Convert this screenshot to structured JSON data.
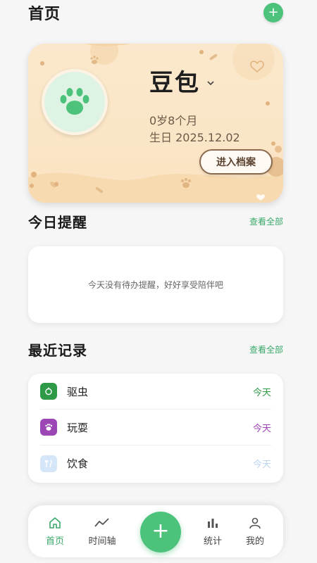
{
  "header": {
    "title": "首页",
    "add_label": "+"
  },
  "pet": {
    "name": "豆包",
    "age": "0岁8个月",
    "birthday": "生日 2025.12.02",
    "profile_button": "进入档案"
  },
  "reminders": {
    "title": "今日提醒",
    "see_all": "查看全部",
    "empty_text": "今天没有待办提醒，好好享受陪伴吧"
  },
  "records": {
    "title": "最近记录",
    "see_all": "查看全部",
    "items": [
      {
        "label": "驱虫",
        "time": "今天",
        "icon": "deworm-icon",
        "color": "#2e9a48",
        "time_color": "#2e9a48"
      },
      {
        "label": "玩耍",
        "time": "今天",
        "icon": "play-icon",
        "color": "#9c45b5",
        "time_color": "#9c45b5"
      },
      {
        "label": "饮食",
        "time": "今天",
        "icon": "food-icon",
        "color": "#c9dff5",
        "time_color": "#bcd6ef"
      }
    ]
  },
  "tabbar": {
    "tabs": [
      {
        "label": "首页",
        "icon": "home-icon"
      },
      {
        "label": "时间轴",
        "icon": "timeline-icon"
      },
      {
        "label": "统计",
        "icon": "stats-icon"
      },
      {
        "label": "我的",
        "icon": "user-icon"
      }
    ],
    "fab_label": "+"
  },
  "colors": {
    "accent": "#4cc27a",
    "accent_text": "#3aa86a",
    "card_bg": "#fbe8cc"
  }
}
